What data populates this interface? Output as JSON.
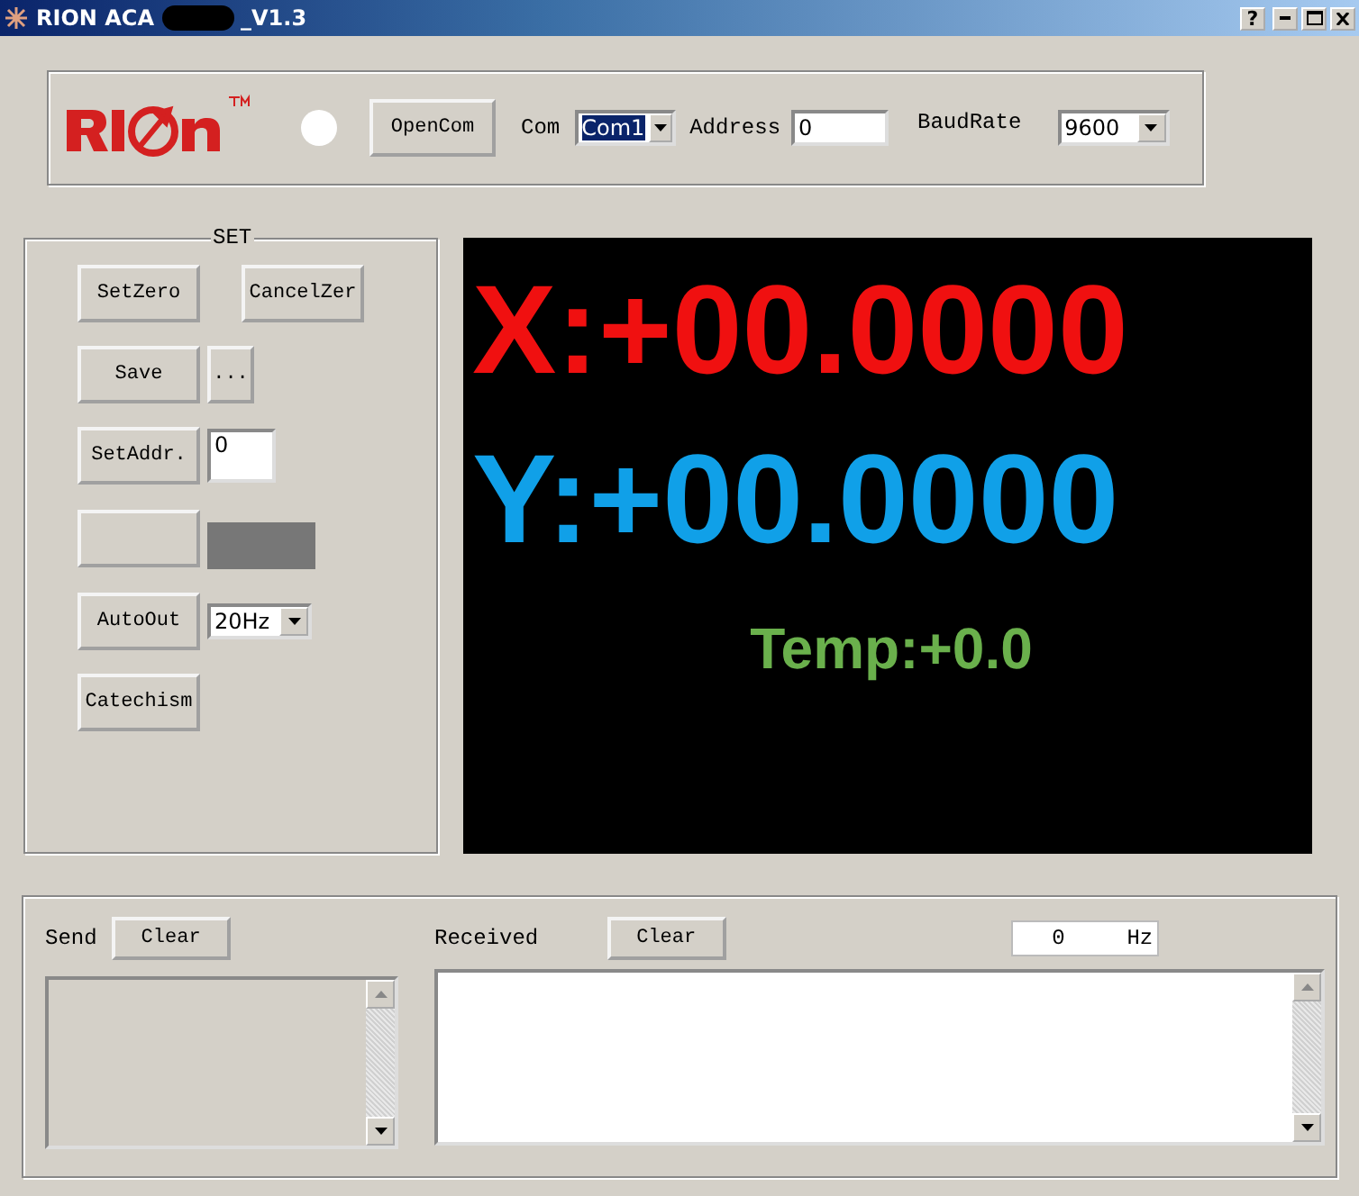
{
  "window": {
    "title_parts": [
      "RION ACA",
      "_V1.3"
    ],
    "help": "?"
  },
  "connection": {
    "status_on": false,
    "open_button": "OpenCom",
    "com_label": "Com",
    "com_value": "Com1",
    "address_label": "Address",
    "address_value": "0",
    "baud_label": "BaudRate",
    "baud_value": "9600"
  },
  "set_panel": {
    "title": "SET",
    "set_zero": "SetZero",
    "cancel_zero": "CancelZer",
    "save": "Save",
    "browse": "...",
    "set_addr": "SetAddr.",
    "addr_value": "0",
    "auto_out": "AutoOut",
    "rate_value": "20Hz",
    "catechism": "Catechism"
  },
  "display": {
    "x": "X:+00.0000",
    "y": "Y:+00.0000",
    "temp": "Temp:+0.0"
  },
  "log": {
    "send_label": "Send",
    "send_clear": "Clear",
    "received_label": "Received",
    "received_clear": "Clear",
    "rate_value": "0",
    "rate_unit": "Hz"
  }
}
